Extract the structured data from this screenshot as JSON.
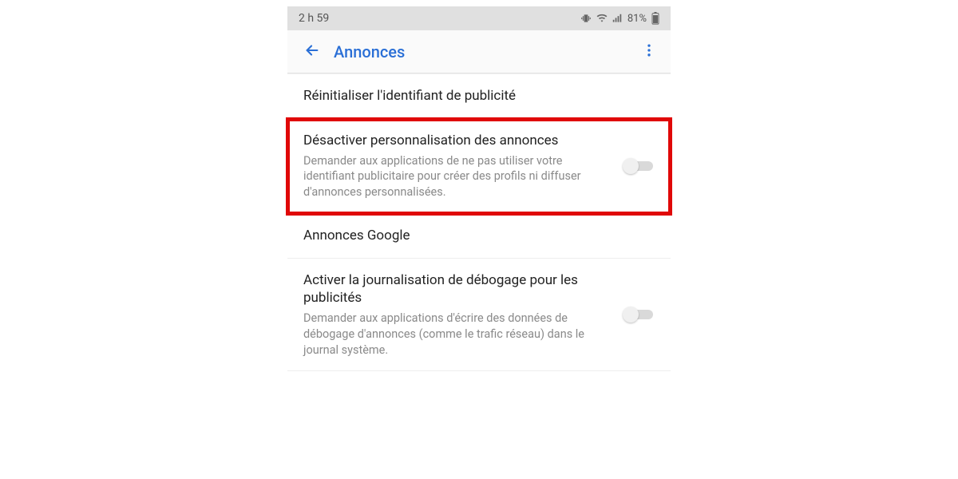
{
  "status_bar": {
    "time": "2 h 59",
    "battery_percent": "81%"
  },
  "app_bar": {
    "title": "Annonces"
  },
  "rows": {
    "reset": {
      "title": "Réinitialiser l'identifiant de publicité"
    },
    "opt_out": {
      "title": "Désactiver personnalisation des annonces",
      "subtitle": "Demander aux applications de ne pas utiliser votre identifiant publicitaire pour créer des profils ni diffuser d'annonces personnalisées."
    },
    "google_ads": {
      "title": "Annonces Google"
    },
    "debug": {
      "title": "Activer la journalisation de débogage pour les publicités",
      "subtitle": "Demander aux applications d'écrire des données de débogage d'annonces (comme le trafic réseau) dans le journal système."
    }
  },
  "highlight_color": "#e00808"
}
